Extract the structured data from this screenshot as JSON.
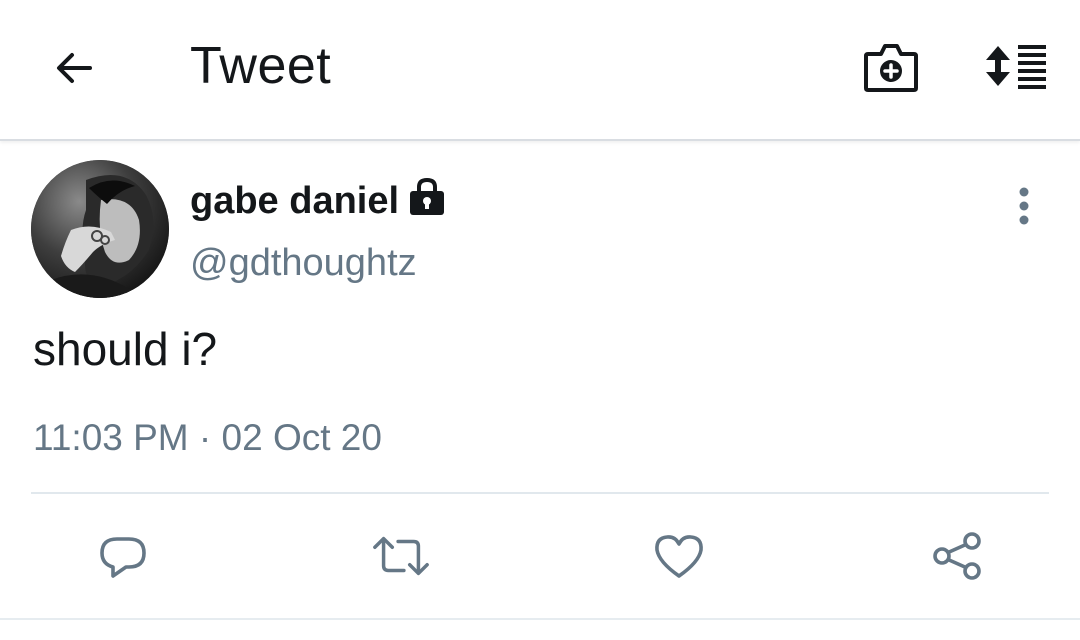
{
  "header": {
    "title": "Tweet",
    "icons": {
      "back": "arrow-left-icon",
      "camera": "camera-plus-icon",
      "sort": "sort-lines-icon"
    }
  },
  "tweet": {
    "author": {
      "display_name": "gabe daniel",
      "handle": "@gdthoughtz",
      "protected": true,
      "avatar": "avatar-photo"
    },
    "text": "should i?",
    "timestamp": "11:03 PM · 02 Oct 20",
    "actions": [
      {
        "name": "reply",
        "icon": "reply-icon"
      },
      {
        "name": "retweet",
        "icon": "retweet-icon"
      },
      {
        "name": "like",
        "icon": "heart-icon"
      },
      {
        "name": "share",
        "icon": "share-icon"
      }
    ]
  },
  "colors": {
    "text_primary": "#14171a",
    "text_secondary": "#657786",
    "icon_gray": "#657786",
    "divider": "#e1e8ed"
  }
}
